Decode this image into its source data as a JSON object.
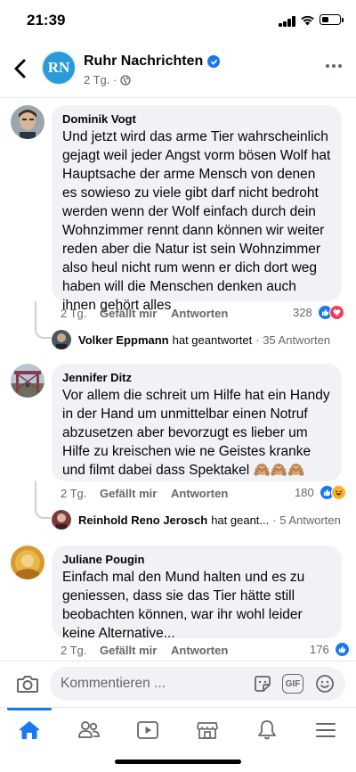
{
  "status_bar": {
    "time": "21:39"
  },
  "header": {
    "avatar_text": "RN",
    "page_name": "Ruhr Nachrichten",
    "meta": "2 Tg. ·"
  },
  "comments": [
    {
      "author": "Dominik Vogt",
      "text": "Und jetzt wird das arme Tier wahrscheinlich gejagt weil jeder Angst vorm bösen Wolf hat Hauptsache der arme Mensch von denen es sowieso zu viele gibt darf nicht bedroht werden wenn der Wolf einfach durch dein Wohnzimmer rennt dann können wir weiter reden aber die Natur ist sein Wohnzimmer also heul nicht rum wenn er dich dort weg haben will die Menschen denken auch ihnen gehört alles",
      "time": "2 Tg.",
      "like_label": "Gefällt mir",
      "reply_label": "Antworten",
      "reaction_count": "328",
      "reply": {
        "name": "Volker Eppmann",
        "text": "hat geantwortet",
        "count": "· 35 Antworten"
      }
    },
    {
      "author": "Jennifer Ditz",
      "text": "Vor allem die schreit um Hilfe hat ein Handy in der Hand um unmittelbar einen Notruf abzusetzen aber bevorzugt es lieber um Hilfe zu kreischen wie ne Geistes kranke und filmt dabei dass Spektakel",
      "emoji": "🙈🙈🙈",
      "time": "2 Tg.",
      "like_label": "Gefällt mir",
      "reply_label": "Antworten",
      "reaction_count": "180",
      "reply": {
        "name": "Reinhold Reno Jerosch",
        "text": "hat geant...",
        "count": "· 5 Antworten"
      }
    },
    {
      "author": "Juliane Pougin",
      "text": "Einfach mal den Mund halten und es zu geniessen, dass sie das Tier hätte still beobachten können, war ihr wohl leider keine Alternative...",
      "time": "2 Tg.",
      "like_label": "Gefällt mir",
      "reply_label": "Antworten",
      "reaction_count": "176"
    }
  ],
  "composer": {
    "placeholder": "Kommentieren ...",
    "gif_label": "GIF"
  },
  "colors": {
    "brand": "#1877f2",
    "bubble": "#f0f2f5",
    "love": "#f33e58",
    "haha": "#f7b125"
  },
  "nav": [
    "home-icon",
    "friends-icon",
    "watch-icon",
    "marketplace-icon",
    "notifications-icon",
    "menu-icon"
  ]
}
